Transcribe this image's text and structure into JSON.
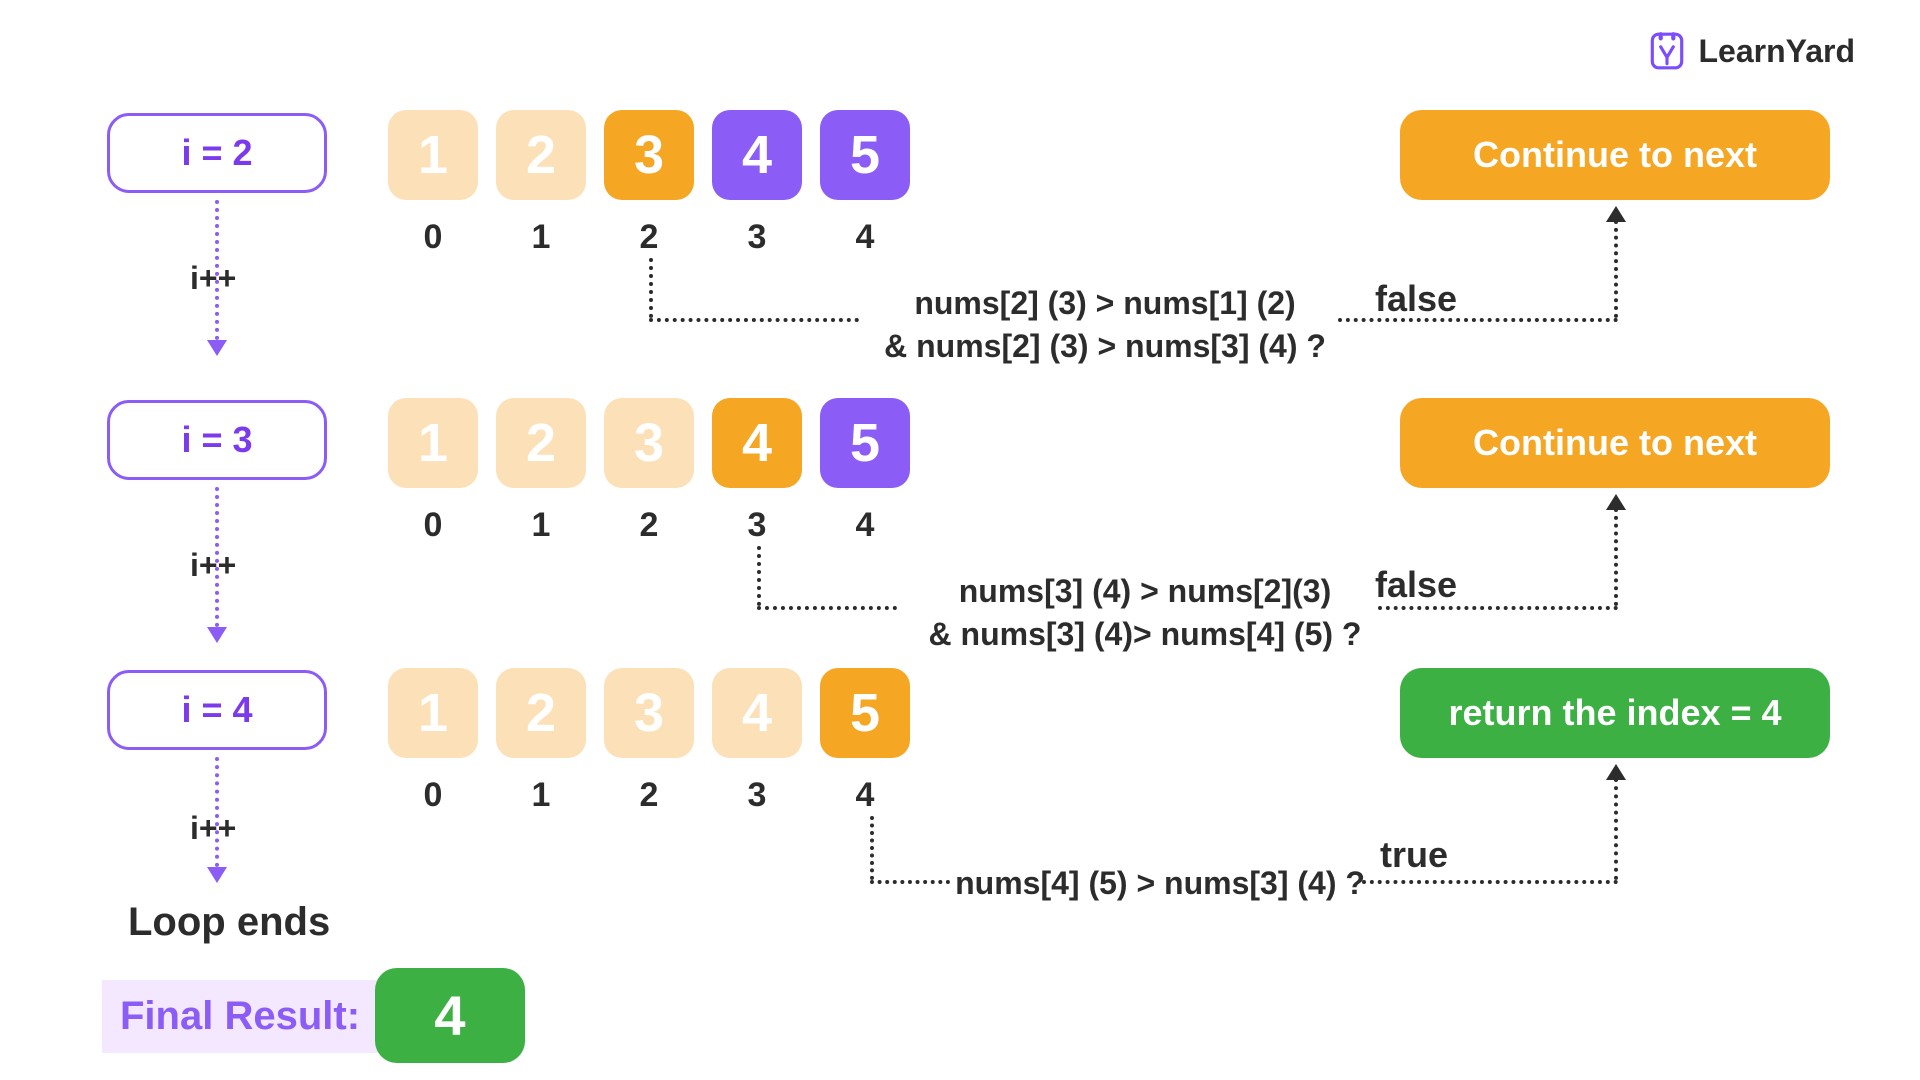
{
  "brand": {
    "name": "LearnYard"
  },
  "rows": [
    {
      "i_label": "i = 2",
      "ipp": "i++",
      "cells": [
        {
          "v": "1",
          "cls": "c-faint"
        },
        {
          "v": "2",
          "cls": "c-faint"
        },
        {
          "v": "3",
          "cls": "c-orange"
        },
        {
          "v": "4",
          "cls": "c-purple"
        },
        {
          "v": "5",
          "cls": "c-purple"
        }
      ],
      "indices": [
        "0",
        "1",
        "2",
        "3",
        "4"
      ],
      "condition_line1": "nums[2] (3) > nums[1] (2)",
      "condition_line2": "& nums[2] (3) > nums[3] (4) ?",
      "verdict": "false",
      "action": "Continue to next",
      "action_cls": "a-orange"
    },
    {
      "i_label": "i = 3",
      "ipp": "i++",
      "cells": [
        {
          "v": "1",
          "cls": "c-faint"
        },
        {
          "v": "2",
          "cls": "c-faint"
        },
        {
          "v": "3",
          "cls": "c-faint"
        },
        {
          "v": "4",
          "cls": "c-orange"
        },
        {
          "v": "5",
          "cls": "c-purple"
        }
      ],
      "indices": [
        "0",
        "1",
        "2",
        "3",
        "4"
      ],
      "condition_line1": "nums[3] (4) > nums[2](3)",
      "condition_line2": "& nums[3] (4)> nums[4] (5) ?",
      "verdict": "false",
      "action": "Continue to next",
      "action_cls": "a-orange"
    },
    {
      "i_label": "i = 4",
      "ipp": "i++",
      "cells": [
        {
          "v": "1",
          "cls": "c-faint"
        },
        {
          "v": "2",
          "cls": "c-faint"
        },
        {
          "v": "3",
          "cls": "c-faint"
        },
        {
          "v": "4",
          "cls": "c-faint"
        },
        {
          "v": "5",
          "cls": "c-orange"
        }
      ],
      "indices": [
        "0",
        "1",
        "2",
        "3",
        "4"
      ],
      "condition_line1": "nums[4] (5) > nums[3] (4) ?",
      "condition_line2": "",
      "verdict": "true",
      "action": "return the index = 4",
      "action_cls": "a-green"
    }
  ],
  "loop_ends": "Loop ends",
  "final": {
    "label": "Final Result:",
    "value": "4"
  }
}
